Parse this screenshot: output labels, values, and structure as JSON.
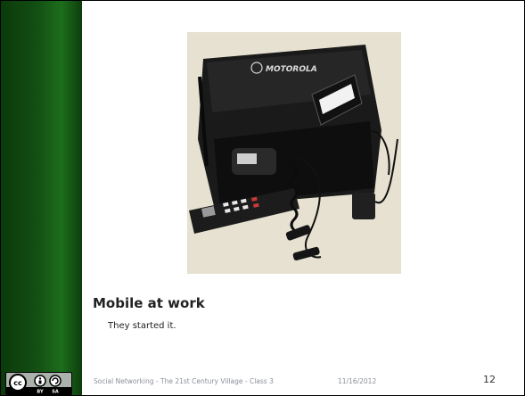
{
  "slide": {
    "title": "Mobile at work",
    "body": "They started it.",
    "footer": "Social Networking - The 21st Century Village - Class 3",
    "date": "11/16/2012",
    "page_number": "12"
  },
  "image": {
    "brand_text": "MOTOROLA"
  },
  "license_badge": {
    "cc_text": "cc",
    "by_text": "BY",
    "sa_text": "SA"
  },
  "colors": {
    "left_band": "#134f13",
    "footer_text": "#8a8f9a"
  }
}
